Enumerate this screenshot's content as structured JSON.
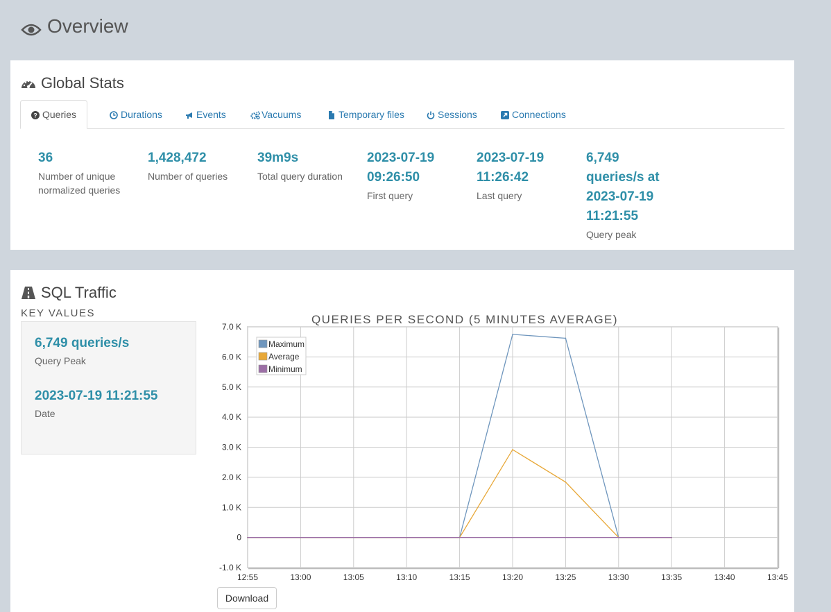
{
  "page": {
    "title": "Overview"
  },
  "global_stats": {
    "title": "Global Stats",
    "tabs": [
      {
        "label": "Queries",
        "icon": "question-circle-icon",
        "active": true
      },
      {
        "label": "Durations",
        "icon": "clock-icon",
        "active": false
      },
      {
        "label": "Events",
        "icon": "bullhorn-icon",
        "active": false
      },
      {
        "label": "Vacuums",
        "icon": "cogs-icon",
        "active": false
      },
      {
        "label": "Temporary files",
        "icon": "file-icon",
        "active": false
      },
      {
        "label": "Sessions",
        "icon": "power-icon",
        "active": false
      },
      {
        "label": "Connections",
        "icon": "external-link-icon",
        "active": false
      }
    ],
    "stats": [
      {
        "value": "36",
        "label": "Number of unique normalized queries"
      },
      {
        "value": "1,428,472",
        "label": "Number of queries"
      },
      {
        "value": "39m9s",
        "label": "Total query duration"
      },
      {
        "value": "2023-07-19 09:26:50",
        "label": "First query"
      },
      {
        "value": "2023-07-19 11:26:42",
        "label": "Last query"
      },
      {
        "value": "6,749 queries/s at 2023-07-19 11:21:55",
        "label": "Query peak"
      }
    ]
  },
  "sql_traffic": {
    "title": "SQL Traffic",
    "key_values_title": "KEY VALUES",
    "peak_value": "6,749 queries/s",
    "peak_label": "Query Peak",
    "date_value": "2023-07-19 11:21:55",
    "date_label": "Date",
    "download_label": "Download"
  },
  "chart_data": {
    "type": "line",
    "title": "QUERIES PER SECOND (5 MINUTES AVERAGE)",
    "xlabel": "",
    "ylabel": "",
    "x_ticks": [
      "12:55",
      "13:00",
      "13:05",
      "13:10",
      "13:15",
      "13:20",
      "13:25",
      "13:30",
      "13:35",
      "13:40",
      "13:45"
    ],
    "y_ticks": [
      "-1.0 K",
      "0",
      "1.0 K",
      "2.0 K",
      "3.0 K",
      "4.0 K",
      "5.0 K",
      "6.0 K",
      "7.0 K"
    ],
    "ylim": [
      -1000,
      7000
    ],
    "xlim": [
      "12:55",
      "13:45"
    ],
    "grid": true,
    "legend_position": "top-left",
    "x": [
      "12:55",
      "13:00",
      "13:05",
      "13:10",
      "13:15",
      "13:20",
      "13:25",
      "13:30",
      "13:35"
    ],
    "series": [
      {
        "name": "Maximum",
        "color": "#6f96bd",
        "values": [
          0,
          0,
          0,
          0,
          0,
          6749,
          6620,
          0,
          0
        ]
      },
      {
        "name": "Average",
        "color": "#e8a838",
        "values": [
          0,
          0,
          0,
          0,
          0,
          2920,
          1840,
          0,
          0
        ]
      },
      {
        "name": "Minimum",
        "color": "#9c6fa6",
        "values": [
          0,
          0,
          0,
          0,
          0,
          0,
          0,
          0,
          0
        ]
      }
    ]
  }
}
